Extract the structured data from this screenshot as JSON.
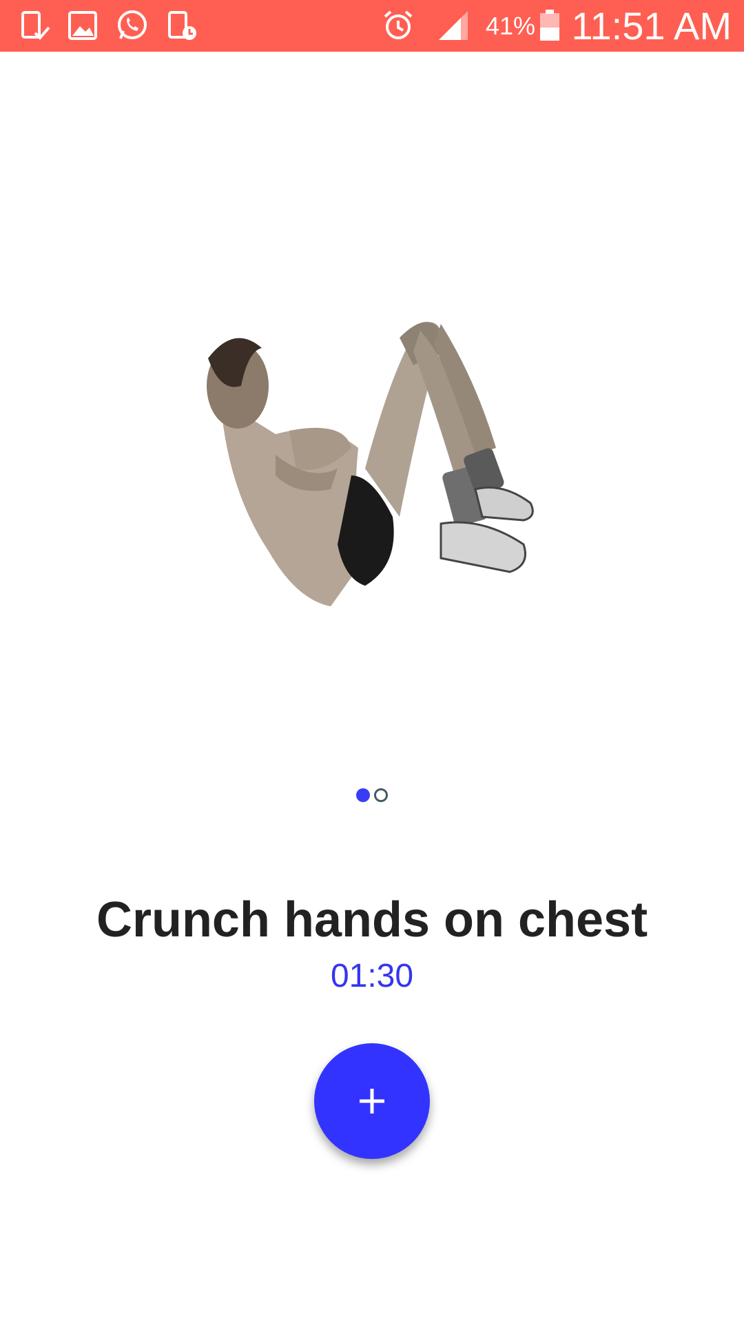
{
  "status_bar": {
    "background": "#ff5f52",
    "left_icons": [
      "sim-check-icon",
      "gallery-icon",
      "whatsapp-icon",
      "sim-clock-icon"
    ],
    "right_icons": [
      "alarm-icon",
      "signal-icon",
      "battery-icon"
    ],
    "battery_percent": "41%",
    "time": "11:51 AM"
  },
  "exercise": {
    "image_icon": "crunch-illustration",
    "title": "Crunch hands on chest",
    "duration": "01:30"
  },
  "pager": {
    "total": 2,
    "active_index": 0,
    "active_color": "#3a3cf5"
  },
  "fab": {
    "icon": "plus-icon",
    "color": "#3333ff"
  }
}
